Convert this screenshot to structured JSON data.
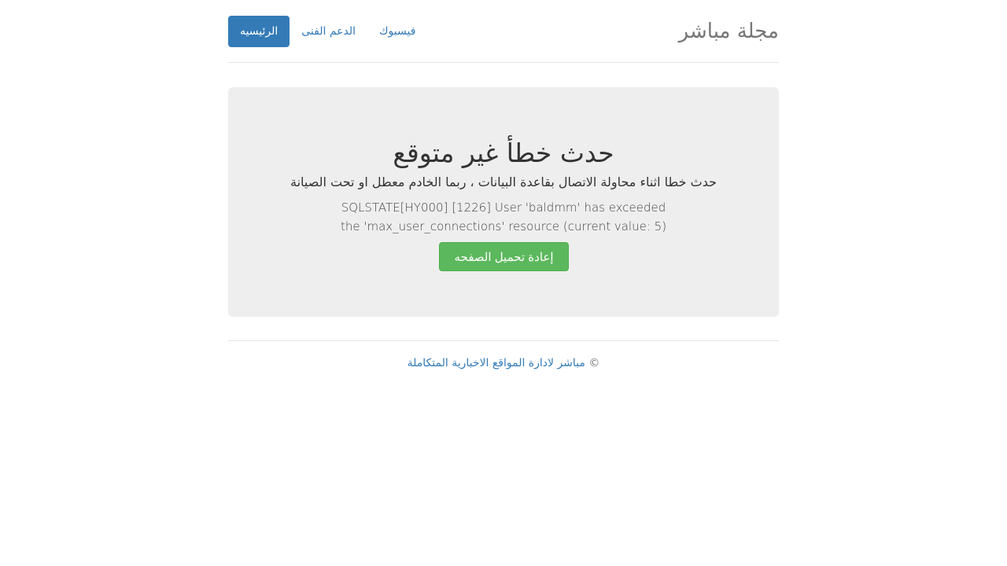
{
  "header": {
    "brand": "مجلة مباشر",
    "nav": [
      {
        "label": "الرئيسيه",
        "active": true
      },
      {
        "label": "الدعم الفنى",
        "active": false
      },
      {
        "label": "فيسبوك",
        "active": false
      }
    ]
  },
  "error_panel": {
    "title": "حدث خطأ غير متوقع",
    "lead": "حدث خطا اثناء محاولة الاتصال بقاعدة البيانات ، ربما الخادم معطل او تحت الصيانة",
    "message": "SQLSTATE[HY000] [1226] User 'baldmm' has exceeded the 'max_user_connections' resource (current value: 5)",
    "reload_button": "إعادة تحميل الصفحه"
  },
  "footer": {
    "copyright_symbol": "©",
    "link_text": "مباشر لادارة المواقع الاخبارية المتكاملة"
  },
  "colors": {
    "primary": "#337ab7",
    "success": "#5cb85c",
    "panel_bg": "#eeeeee"
  }
}
